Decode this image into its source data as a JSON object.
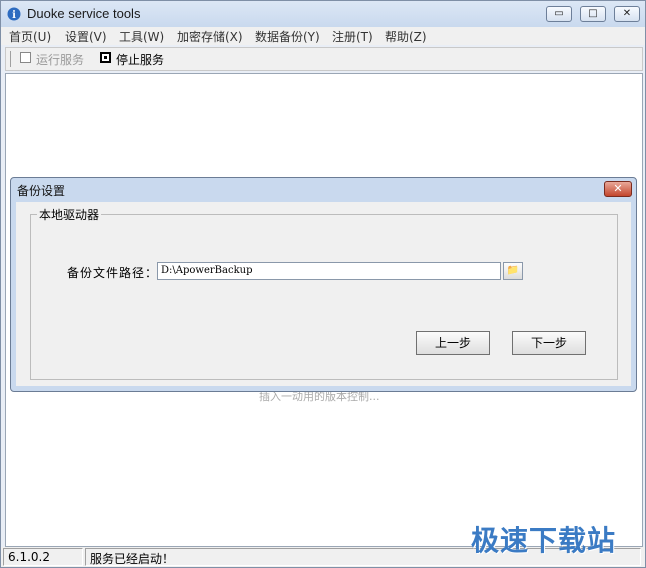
{
  "window": {
    "title": "Duoke service tools",
    "icon": "info-i-icon"
  },
  "titlebar_buttons": {
    "minimize": "▭",
    "maximize": "□",
    "close": "✕"
  },
  "menu": [
    "首页(U)",
    "设置(V)",
    "工具(W)",
    "加密存储(X)",
    "数据备份(Y)",
    "注册(T)",
    "帮助(Z)"
  ],
  "toolbar": {
    "run_label": "运行服务",
    "stop_label": "停止服务"
  },
  "background_text": "插入一动用的版本控制...",
  "dialog": {
    "title": "备份设置",
    "close": "✕",
    "group_label": "本地驱动器",
    "path_label": "备份文件路径：",
    "path_value": "D:\\ApowerBackup",
    "browse_label": "📁",
    "prev_button": "上一步",
    "next_button": "下一步"
  },
  "status": {
    "version": "6.1.0.2",
    "message": "服务已经启动！"
  },
  "watermark": "极速下载站"
}
